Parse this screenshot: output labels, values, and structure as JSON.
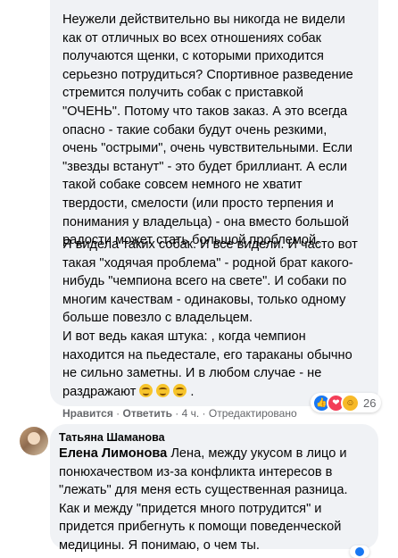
{
  "comment1": {
    "paragraph1": "Неужели действительно вы никогда не видели\nкак от отличных во всех отношениях собак\nполучаются щенки, с которыми приходится\nсерьезно потрудиться? Спортивное разведение\nстремится получить собак с приставкой\n\"ОЧЕНЬ\". Потому что таков заказ. А это всегда\nопасно - такие собаки будут очень резкими,\nочень \"острыми\", очень чувствительными. Если\n\"звезды встанут\" - это будет бриллиант. А если\nтакой собаке совсем немного не хватит\nтвердости, смелости (или просто терпения и\nпонимания у владельца) - она вместо большой\nрадости может стать большой проблемой.",
    "paragraph2": "Я видела таких собак. И все видели. И часто вот\nтакая \"ходячая проблема\" - родной брат какого-\nнибудь \"чемпиона всего на свете\". И собаки по\nмногим качествам - одинаковы, только одному\nбольше повезло с владельцем.\nИ вот ведь какая штука: , когда чемпион\nнаходится на пьедестале, его тараканы обычно\nне сильно заметны. И в любом случае - не\nраздражают",
    "trailing": " .",
    "reaction_count": "26",
    "actions": {
      "like": "Нравится",
      "reply": "Ответить",
      "time": "4 ч.",
      "edited": "Отредактировано",
      "sep": " · "
    }
  },
  "comment2": {
    "author": "Татьяна Шаманова",
    "mention": "Елена Лимонова",
    "text": " Лена, между укусом в лицо и\nпонюхачеством из-за конфликта интересов в\n\"лежать\" для меня есть существенная разница.\nКак и между \"придется много потрудится\" и\nпридется прибегнуть к помощи поведенческой\nмедицины. Я понимаю, о чем ты."
  },
  "icons": {
    "like": "thumbs-up-icon",
    "love": "heart-icon",
    "care": "care-emoji-icon",
    "wink": "wink-emoji-icon"
  }
}
